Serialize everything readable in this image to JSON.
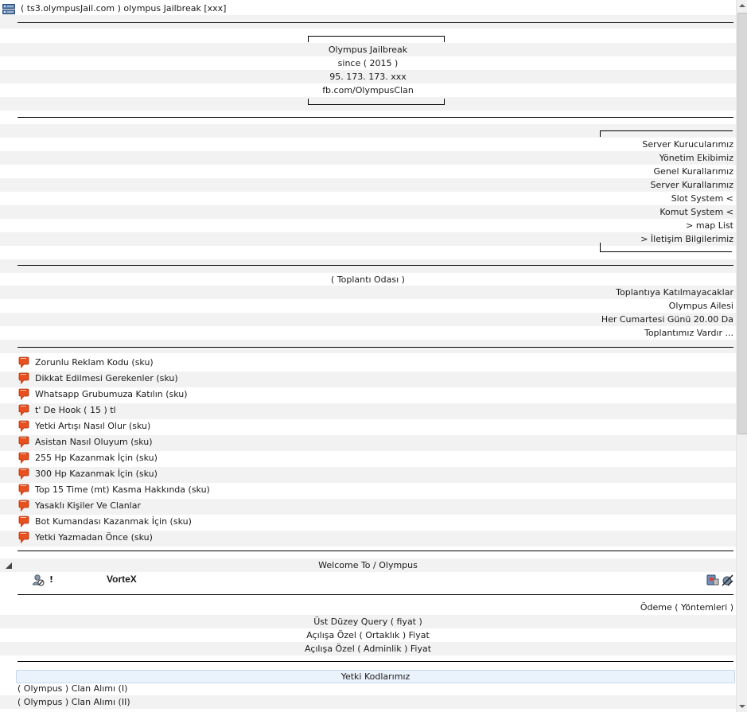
{
  "server": {
    "name": "( ts3.olympusJail.com ) olympus Jailbreak [xxx]",
    "icon": "server-icon"
  },
  "info_box": {
    "lines": [
      "Olympus Jailbreak",
      "since ( 2015 )",
      "95. 173. 173. xxx",
      "fb.com/OlympusClan"
    ]
  },
  "menu_box": {
    "lines": [
      "Server Kurucularımız",
      "Yönetim Ekibimiz",
      "Genel Kurallarımız",
      "Server Kurallarımız",
      "Slot System <",
      "Komut System <",
      "> map List",
      "> İletişim Bilgilerimiz"
    ]
  },
  "meeting": {
    "title": "( Toplantı Odası )",
    "lines": [
      "Toplantıya Katılmayacaklar",
      "Olympus Ailesi",
      "Her Cumartesi Günü 20.00 Da",
      "Toplantımız Vardır ..."
    ]
  },
  "messages": {
    "icon": "chat-bubble-icon",
    "items": [
      "Zorunlu Reklam Kodu (sku)",
      "Dikkat Edilmesi Gerekenler (sku)",
      "Whatsapp Grubumuza Katılın (sku)",
      "t' De  Hook ( 15 ) tl",
      "Yetki Artışı Nasıl Olur (sku)",
      "Asistan Nasıl Oluyum (sku)",
      "255 Hp Kazanmak İçin (sku)",
      "300 Hp Kazanmak İçin (sku)",
      "Top 15 Time (mt) Kasma Hakkında (sku)",
      "Yasaklı Kişiler Ve Clanlar",
      "Bot Kumandası Kazanmak İçin (sku)",
      "Yetki Yazmadan Önce (sku)"
    ]
  },
  "welcome_channel": {
    "title": "Welcome To / Olympus",
    "expanded": true
  },
  "client": {
    "status_icon": "muted-client-icon",
    "prefix": "!",
    "name": "VorteX",
    "right_icons": [
      "channel-commander-icon",
      "output-muted-icon"
    ]
  },
  "payment": {
    "lines": [
      "Ödeme ( Yöntemleri )",
      "Üst Düzey Query ( fiyat )",
      "Açılışa Özel ( Ortaklık ) Fiyat",
      "Açılışa Özel ( Adminlik ) Fiyat"
    ]
  },
  "permissions": {
    "title": "Yetki Kodlarımız",
    "items": [
      "( Olympus ) Clan Alımı (I)",
      "( Olympus ) Clan Alımı (II)"
    ]
  },
  "colors": {
    "stripe": "#f2f2f2",
    "selected_bg": "#eaf2fb",
    "bubble": "#e8501e"
  }
}
